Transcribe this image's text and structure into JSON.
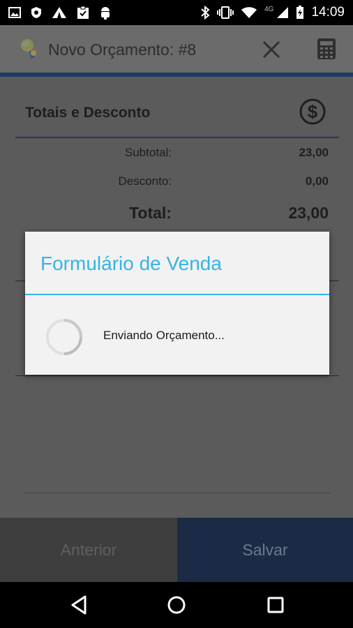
{
  "status_bar": {
    "network": "4G",
    "time": "14:09"
  },
  "app_bar": {
    "title": "Novo Orçamento: #8"
  },
  "totals": {
    "section_title": "Totais e Desconto",
    "subtotal_label": "Subtotal:",
    "subtotal_value": "23,00",
    "discount_label": "Desconto:",
    "discount_value": "0,00",
    "total_label": "Total:",
    "total_value": "23,00"
  },
  "bottom_bar": {
    "previous_label": "Anterior",
    "save_label": "Salvar"
  },
  "dialog": {
    "title": "Formulário de Venda",
    "message": "Enviando Orçamento..."
  },
  "colors": {
    "dialog_accent": "#33b5e5",
    "app_accent": "#1d3a66",
    "save_button": "#1b2b45"
  }
}
